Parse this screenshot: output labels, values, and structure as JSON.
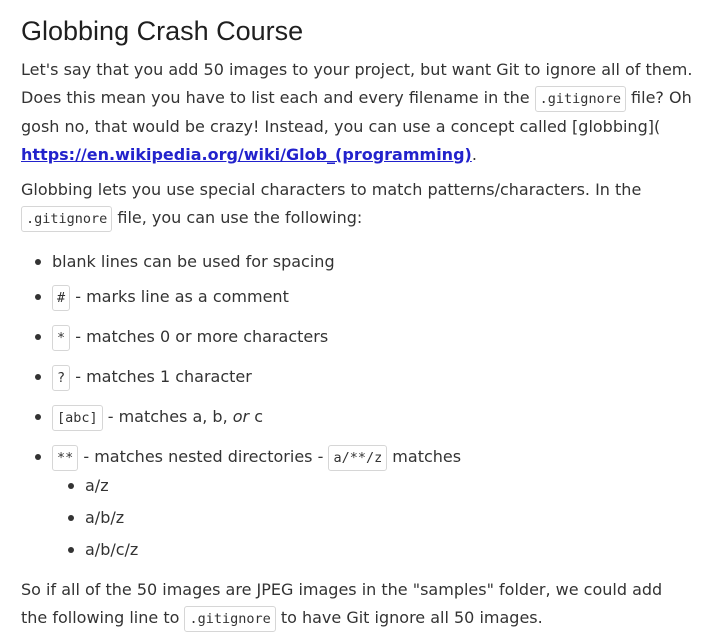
{
  "title": "Globbing Crash Course",
  "para1": {
    "t1": "Let's say that you add 50 images to your project, but want Git to ignore all of them. Does this mean you have to list each and every filename in the ",
    "code": ".gitignore",
    "t2": " file? Oh gosh no, that would be crazy! Instead, you can use a concept called [globbing](",
    "link": "https://en.wikipedia.org/wiki/Glob_(programming)",
    "t3": "."
  },
  "para2": {
    "t1": "Globbing lets you use special characters to match patterns/characters. In the ",
    "code": ".gitignore",
    "t2": " file, you can use the following:"
  },
  "bullets": [
    {
      "text": "blank lines can be used for spacing"
    },
    {
      "code": "#",
      "text": " - marks line as a comment"
    },
    {
      "code": "*",
      "text": " - matches 0 or more characters"
    },
    {
      "code": "?",
      "text": " - matches 1 character"
    },
    {
      "code": "[abc]",
      "text": " - matches a, b, ",
      "em": "or",
      "text2": " c"
    },
    {
      "code": "**",
      "text": " - matches nested directories - ",
      "code2": "a/**/z",
      "text2": " matches"
    }
  ],
  "subitems": [
    "a/z",
    "a/b/z",
    "a/b/c/z"
  ],
  "para3": {
    "t1": "So if all of the 50 images are JPEG images in the \"samples\" folder, we could add the following line to ",
    "code": ".gitignore",
    "t2": " to have Git ignore all 50 images."
  }
}
